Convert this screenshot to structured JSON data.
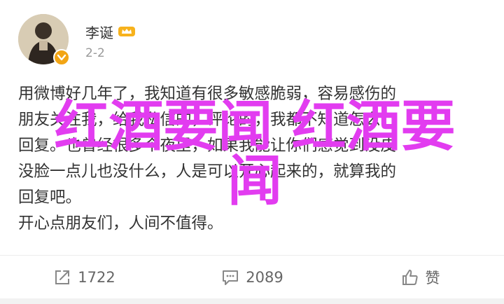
{
  "post": {
    "author": "李诞",
    "time": "2-2",
    "content_lines": [
      "用微博好几年了，我知道有很多敏感脆弱，容易感伤的",
      "朋友关注我，给我私信的，评论的，我都不知道怎么",
      "回复。也曾经很多个夜里，如果我能让你们感觉到没皮",
      "没脸一点儿也没什么，人是可以开心起来的，就算我的",
      "回复吧。",
      "开心点朋友们，人间不值得。"
    ]
  },
  "overlay": {
    "line1": "红酒要闻 红酒要",
    "line2": "闻",
    "color": "#e23cf0"
  },
  "actions": {
    "share_count": "1722",
    "comment_count": "2089",
    "like_label": "赞"
  },
  "icons": {
    "share": "share-icon",
    "comment": "comment-icon",
    "like": "thumbs-up-icon",
    "badge": "crown-badge-icon",
    "verified": "verified-badge-icon"
  }
}
